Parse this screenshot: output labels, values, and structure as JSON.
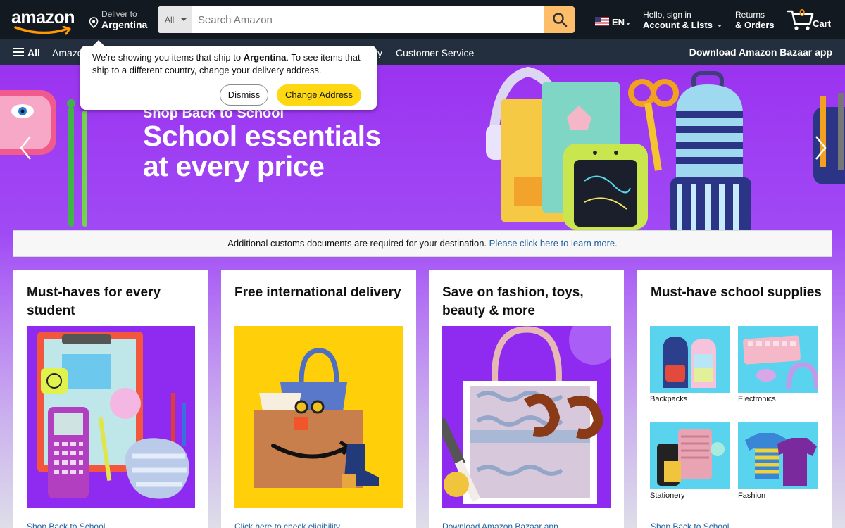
{
  "header": {
    "logo_text": "amazon",
    "deliver_to_label": "Deliver to",
    "deliver_to_location": "Argentina",
    "search": {
      "category": "All",
      "placeholder": "Search Amazon"
    },
    "language": "EN",
    "account_greeting": "Hello, sign in",
    "account_label": "Account & Lists",
    "returns_label": "Returns",
    "orders_label": "& Orders",
    "cart_count": "0",
    "cart_label": "Cart"
  },
  "subnav": {
    "all_label": "All",
    "items": [
      "Amazon",
      "y",
      "Customer Service"
    ],
    "bazaar_label": "Download Amazon Bazaar app"
  },
  "hero": {
    "subtitle": "Shop Back to School",
    "title_line1": "School essentials",
    "title_line2": "at every price"
  },
  "popover": {
    "message_start": "We're showing you items that ship to ",
    "country": "Argentina",
    "message_end": ". To see items that ship to a different country, change your delivery address.",
    "dismiss_label": "Dismiss",
    "change_label": "Change Address"
  },
  "notice": {
    "text": "Additional customs documents are required for your destination.",
    "link": "Please click here to learn more."
  },
  "cards": [
    {
      "title": "Must-haves for every student",
      "link": "Shop Back to School"
    },
    {
      "title": "Free international delivery",
      "link": "Click here to check eligibility"
    },
    {
      "title": "Save on fashion, toys, beauty & more",
      "link": "Download Amazon Bazaar app"
    },
    {
      "title": "Must-have school supplies",
      "link": "Shop Back to School",
      "tiles": [
        {
          "label": "Backpacks"
        },
        {
          "label": "Electronics"
        },
        {
          "label": "Stationery"
        },
        {
          "label": "Fashion"
        }
      ]
    }
  ],
  "colors": {
    "nav_dark": "#131921",
    "nav_sub": "#232f3e",
    "search_button": "#febd69",
    "primary_button": "#ffd814",
    "hero_purple": "#9b33f0",
    "link_blue": "#2162a1",
    "cart_orange": "#f08804"
  }
}
